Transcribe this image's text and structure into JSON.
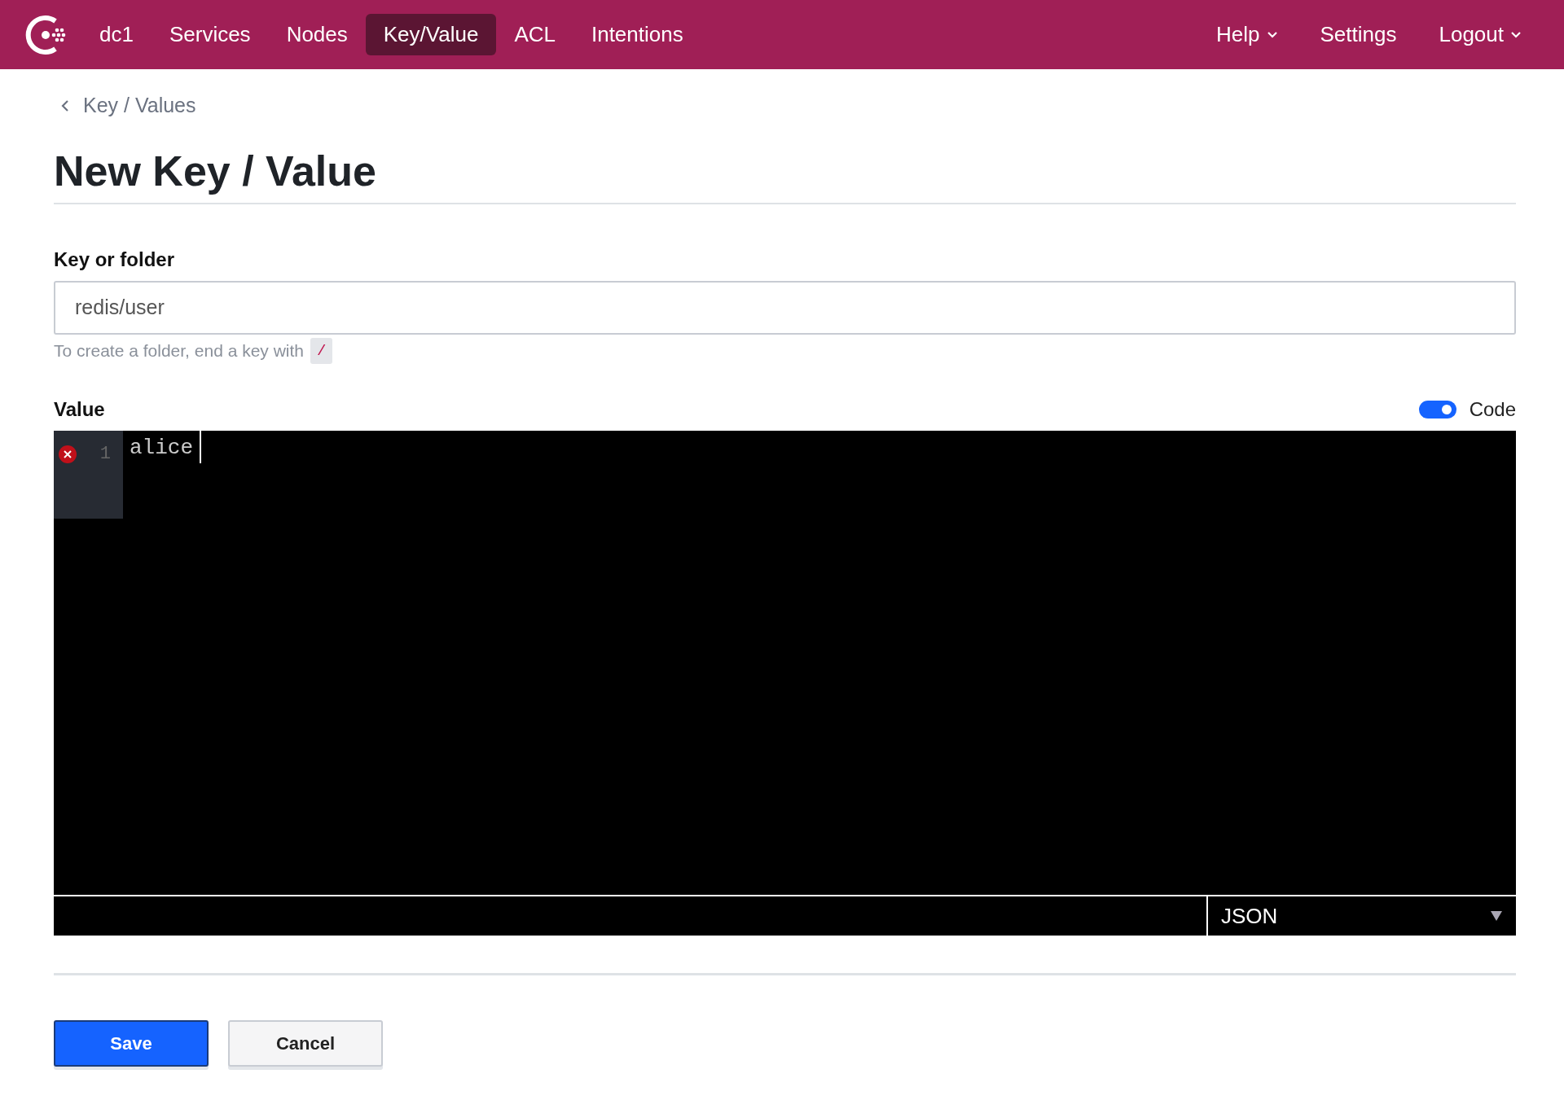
{
  "navbar": {
    "items": [
      {
        "label": "dc1",
        "selected": false
      },
      {
        "label": "Services",
        "selected": false
      },
      {
        "label": "Nodes",
        "selected": false
      },
      {
        "label": "Key/Value",
        "selected": true
      },
      {
        "label": "ACL",
        "selected": false
      },
      {
        "label": "Intentions",
        "selected": false
      }
    ],
    "right_items": [
      {
        "label": "Help",
        "dropdown": true
      },
      {
        "label": "Settings",
        "dropdown": false
      },
      {
        "label": "Logout",
        "dropdown": true
      }
    ]
  },
  "breadcrumb": "Key / Values",
  "title": "New Key / Value",
  "key_field": {
    "label": "Key or folder",
    "value": "redis/user"
  },
  "help": {
    "text": "To create a folder, end a key with",
    "code": "/"
  },
  "value_field": {
    "label": "Value",
    "code_toggle": {
      "label": "Code",
      "on": true
    },
    "editor": {
      "lines": [
        {
          "number": "1",
          "text": "alice",
          "error": true
        }
      ],
      "mode": "JSON"
    }
  },
  "buttons": [
    {
      "label": "Save",
      "kind": "primary"
    },
    {
      "label": "Cancel",
      "kind": "secondary"
    }
  ]
}
